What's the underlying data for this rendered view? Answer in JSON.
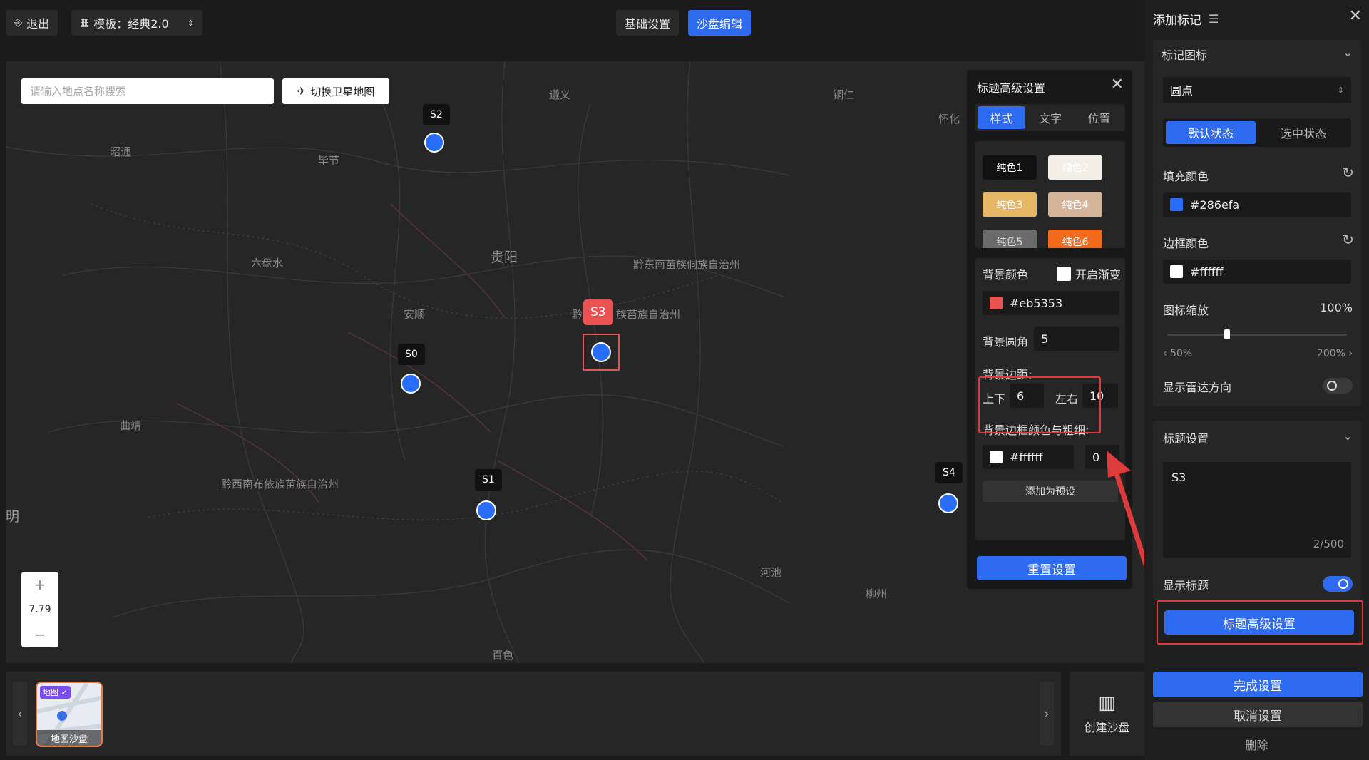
{
  "topbar": {
    "exit_label": "退出",
    "template_label": "模板：经典2.0",
    "basic_settings_label": "基础设置",
    "sandbox_edit_label": "沙盘编辑"
  },
  "map": {
    "search_placeholder": "请输入地点名称搜索",
    "satellite_button_label": "切换卫星地图",
    "zoom_level": "7.79",
    "zoom_in": "+",
    "zoom_out": "−",
    "places": {
      "zunyi": "遵义",
      "tongren": "铜仁",
      "huaihua": "怀化",
      "zhaotong": "昭通",
      "bijie": "毕节",
      "guiyang": "贵阳",
      "liupanshui": "六盘水",
      "qiandongnan": "黔东南苗族侗族自治州",
      "anshun": "安顺",
      "qiannan_prefix": "黔",
      "qiannan_suffix": "族苗族自治州",
      "qujing": "曲靖",
      "qianxinan": "黔西南布依族苗族自治州",
      "hechi": "河池",
      "liuzhou": "柳州",
      "baise": "百色",
      "kunming_partial": "明"
    },
    "markers": {
      "s0": "S0",
      "s1": "S1",
      "s2": "S2",
      "s3": "S3",
      "s4": "S4"
    }
  },
  "title_popup": {
    "title": "标题高级设置",
    "tabs": [
      "样式",
      "文字",
      "位置"
    ],
    "swatches": [
      {
        "label": "纯色1",
        "bg": "#111111",
        "fg": "#ffffff"
      },
      {
        "label": "纯色2",
        "bg": "#f3efe6",
        "fg": "#ffffff"
      },
      {
        "label": "纯色3",
        "bg": "#e6b865",
        "fg": "#ffffff"
      },
      {
        "label": "纯色4",
        "bg": "#d4b59a",
        "fg": "#ffffff"
      },
      {
        "label": "纯色5",
        "bg": "#6b6b6b",
        "fg": "#dddddd"
      },
      {
        "label": "纯色6",
        "bg": "#f26a1b",
        "fg": "#ffffff"
      }
    ],
    "bg_color_label": "背景颜色",
    "gradient_label": "开启渐变",
    "bg_color_value": "#eb5353",
    "radius_label": "背景圆角",
    "radius_value": "5",
    "padding_label": "背景边距:",
    "padding_v_label": "上下",
    "padding_v_value": "6",
    "padding_h_label": "左右",
    "padding_h_value": "10",
    "border_label": "背景边框颜色与粗细:",
    "border_color_value": "#ffffff",
    "border_width_value": "0",
    "add_preset_label": "添加为预设",
    "reset_label": "重置设置"
  },
  "bottom": {
    "thumb_tag": "地图 ✓",
    "thumb_caption": "地图沙盘",
    "create_label": "创建沙盘"
  },
  "right_panel": {
    "title": "添加标记",
    "icon_section_label": "标记图标",
    "icon_select_value": "圆点",
    "state_default": "默认状态",
    "state_selected": "选中状态",
    "fill_color_label": "填充颜色",
    "fill_color_value": "#286efa",
    "border_color_label": "边框颜色",
    "border_color_value": "#ffffff",
    "icon_scale_label": "图标缩放",
    "icon_scale_value": "100%",
    "icon_scale_fraction": 0.333,
    "scale_min": "50%",
    "scale_max": "200%",
    "radar_label": "显示雷达方向",
    "title_section_label": "标题设置",
    "title_text_value": "S3",
    "char_count": "2/500",
    "show_title_label": "显示标题",
    "advanced_title_button": "标题高级设置",
    "complete_button": "完成设置",
    "cancel_button": "取消设置",
    "delete_button": "删除"
  },
  "colors": {
    "accent": "#2f6bf0",
    "marker_fill": "#286efa",
    "title_bg": "#eb5353",
    "highlight_frame": "#e03b3b"
  }
}
